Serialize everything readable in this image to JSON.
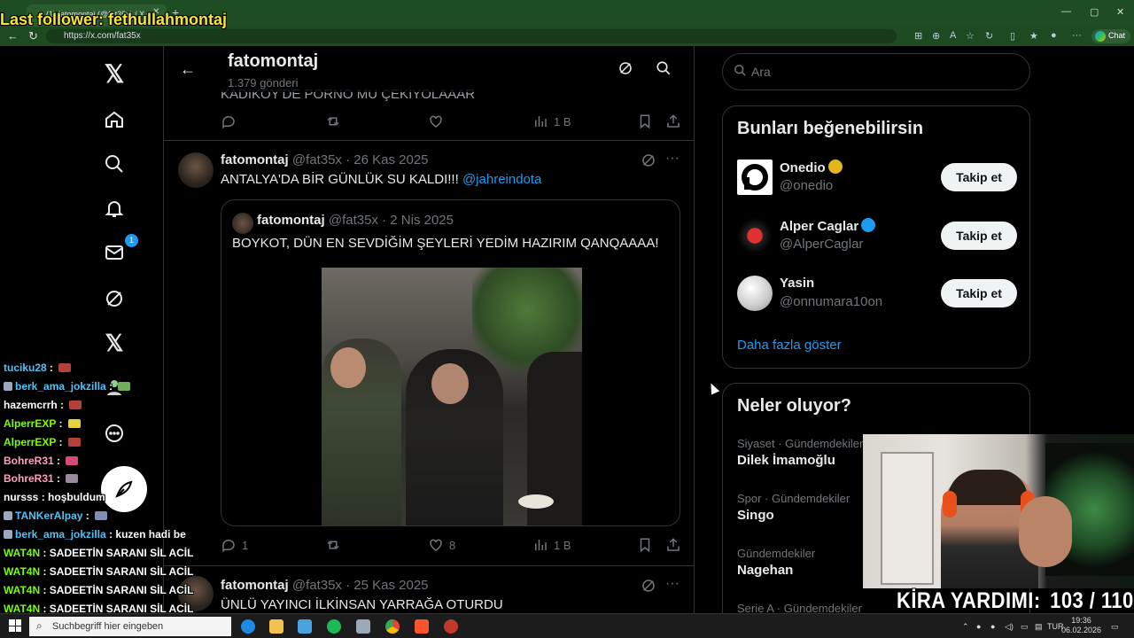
{
  "overlay": {
    "last_follower": "Last follower: fethullahmontaj"
  },
  "browser": {
    "tab_title": "(1) fatomontaj (@fat35x) / X",
    "url": "https://x.com/fat35x",
    "chat_label": "Chat",
    "accent": "#1f4d23"
  },
  "nav": {
    "messages_badge": "1"
  },
  "header": {
    "name": "fatomontaj",
    "post_count": "1.379 gönderi"
  },
  "tweets": [
    {
      "text": "KADIKÖY'DE PORNO MU ÇEKİYOLAAAR",
      "views": "1 B"
    },
    {
      "name": "fatomontaj",
      "handle": "@fat35x",
      "sep": "·",
      "date": "26 Kas 2025",
      "text": "ANTALYA'DA BİR GÜNLÜK SU KALDI!!!",
      "mention": "@jahreindota",
      "quote": {
        "name": "fatomontaj",
        "handle": "@fat35x",
        "sep": "·",
        "date": "2 Nis 2025",
        "text": "BOYKOT, DÜN EN SEVDİĞİM ŞEYLERİ YEDİM HAZIRIM QANQAAAA!"
      },
      "replies": "1",
      "likes": "8",
      "views": "1 B"
    },
    {
      "name": "fatomontaj",
      "handle": "@fat35x",
      "sep": "·",
      "date": "25 Kas 2025",
      "text": "ÜNLÜ YAYINCI İLKİNSAN YARRAĞA OTURDU"
    }
  ],
  "sidebar": {
    "search_placeholder": "Ara",
    "suggest_title": "Bunları beğenebilirsin",
    "follow_label": "Takip et",
    "suggestions": [
      {
        "name": "Onedio",
        "handle": "@onedio",
        "badge_color": "#e2b719"
      },
      {
        "name": "Alper Caglar",
        "handle": "@AlperCaglar",
        "badge_color": "#1d9bf0"
      },
      {
        "name": "Yasin",
        "handle": "@onnumara10on"
      }
    ],
    "show_more": "Daha fazla göster",
    "trends_title": "Neler oluyor?",
    "trends": [
      {
        "category": "Siyaset · Gündemdekiler",
        "name": "Dilek İmamoğlu"
      },
      {
        "category": "Spor · Gündemdekiler",
        "name": "Singo"
      },
      {
        "category": "Gündemdekiler",
        "name": "Nagehan"
      },
      {
        "category": "Serie A · Gündemdekiler"
      }
    ]
  },
  "stream": {
    "kira_label": "KİRA YARDIMI:",
    "kira_value": "103 / 110"
  },
  "chat": [
    {
      "user": "tuciku28",
      "color": "#4fc3f7",
      "msg": "",
      "emote": "#b5423a"
    },
    {
      "user": "berk_ama_jokzilla",
      "color": "#4fc3f7",
      "msg": "",
      "emote": "#6fae5a"
    },
    {
      "user": "hazemcrrh",
      "color": "#ffffff",
      "msg": "",
      "emote": "#b5423a"
    },
    {
      "user": "AlperrEXP",
      "color": "#7cfc00",
      "msg": "",
      "emote": "#e6d23a"
    },
    {
      "user": "AlperrEXP",
      "color": "#7cfc00",
      "msg": "",
      "emote": "#b5423a"
    },
    {
      "user": "BohreR31",
      "color": "#ff9ec4",
      "msg": "",
      "emote": "#d9487a"
    },
    {
      "user": "BohreR31",
      "color": "#ff9ec4",
      "msg": "",
      "emote": "#9a8aa0"
    },
    {
      "user": "nursss",
      "color": "#ffffff",
      "msg": "hoşbuldum"
    },
    {
      "user": "TANKerAlpay",
      "color": "#4fc3f7",
      "msg": "",
      "emote": "#7d8db3"
    },
    {
      "user": "berk_ama_jokzilla",
      "color": "#4fc3f7",
      "msg": "kuzen hadi be"
    },
    {
      "user": "WAT4N",
      "color": "#7cfc00",
      "msg": "SADEETİN SARANI SİL ACİL"
    },
    {
      "user": "WAT4N",
      "color": "#7cfc00",
      "msg": "SADEETİN SARANI SİL ACİL"
    },
    {
      "user": "WAT4N",
      "color": "#7cfc00",
      "msg": "SADEETİN SARANI SİL ACİL"
    },
    {
      "user": "WAT4N",
      "color": "#7cfc00",
      "msg": "SADEETİN SARANI SİL ACİL"
    }
  ],
  "taskbar": {
    "search_placeholder": "Suchbegriff hier eingeben",
    "lang": "TUR",
    "time": "19:36",
    "date": "06.02.2026"
  }
}
